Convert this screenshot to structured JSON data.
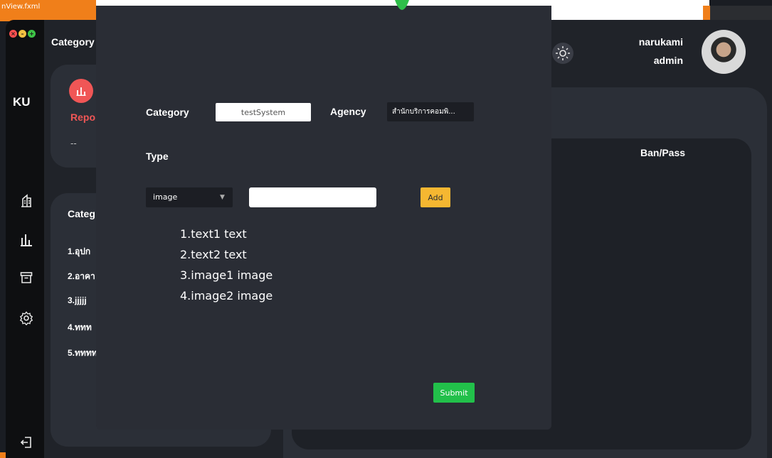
{
  "background": {
    "title_fragment": "nView.fxml"
  },
  "app": {
    "title": "Category",
    "logo": "KU",
    "sidebar": {
      "icons": [
        "building-icon",
        "chart-icon",
        "archive-icon",
        "gear-icon",
        "logout-icon"
      ]
    },
    "user": {
      "name": "narukami",
      "role": "admin"
    },
    "report_card": {
      "label": "Repo",
      "value": "--"
    },
    "category_card": {
      "title": "Categ",
      "items": [
        "1.อุปก",
        "2.อาคา",
        "3.jjjjj",
        "4.ททท",
        "5.ทททท"
      ]
    },
    "right_panel": {
      "column_header": "Ban/Pass"
    }
  },
  "modal": {
    "category_label": "Category",
    "category_value": "testSystem",
    "agency_label": "Agency",
    "agency_value": "สำนักบริการคอมพิ...",
    "type_label": "Type",
    "type_select_value": "image",
    "type_input_value": "",
    "add_label": "Add",
    "types": [
      "1.text1 text",
      "2.text2 text",
      "3.image1 image",
      "4.image2 image"
    ],
    "submit_label": "Submit"
  },
  "colors": {
    "accent_red": "#f05656",
    "add_button": "#f5b731",
    "submit_button": "#22c04a",
    "background_orange": "#f07f1a"
  }
}
